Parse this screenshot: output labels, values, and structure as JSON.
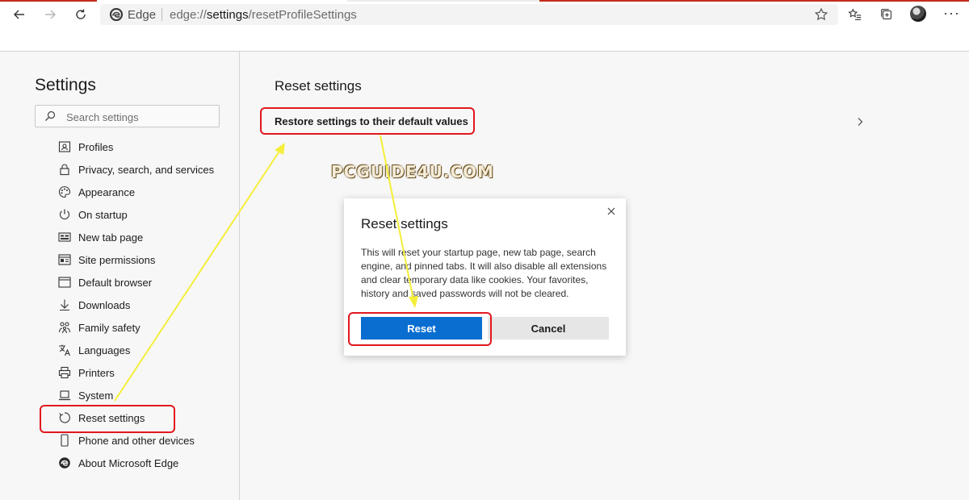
{
  "browser": {
    "brand": "Edge",
    "url_prefix": "edge://",
    "url_strong": "settings",
    "url_rest": "/resetProfileSettings"
  },
  "sidebar": {
    "title": "Settings",
    "search_placeholder": "Search settings",
    "items": [
      {
        "label": "Profiles",
        "icon": "profile-icon"
      },
      {
        "label": "Privacy, search, and services",
        "icon": "lock-icon"
      },
      {
        "label": "Appearance",
        "icon": "palette-icon"
      },
      {
        "label": "On startup",
        "icon": "power-icon"
      },
      {
        "label": "New tab page",
        "icon": "newtab-icon"
      },
      {
        "label": "Site permissions",
        "icon": "site-permissions-icon"
      },
      {
        "label": "Default browser",
        "icon": "browser-icon"
      },
      {
        "label": "Downloads",
        "icon": "download-icon"
      },
      {
        "label": "Family safety",
        "icon": "family-icon"
      },
      {
        "label": "Languages",
        "icon": "language-icon"
      },
      {
        "label": "Printers",
        "icon": "printer-icon"
      },
      {
        "label": "System",
        "icon": "laptop-icon"
      },
      {
        "label": "Reset settings",
        "icon": "reset-icon"
      },
      {
        "label": "Phone and other devices",
        "icon": "phone-icon"
      },
      {
        "label": "About Microsoft Edge",
        "icon": "edge-logo-icon"
      }
    ]
  },
  "main": {
    "title": "Reset settings",
    "restore_label": "Restore settings to their default values"
  },
  "watermark": "PCGUIDE4U.COM",
  "dialog": {
    "title": "Reset settings",
    "body": "This will reset your startup page, new tab page, search engine, and pinned tabs. It will also disable all extensions and clear temporary data like cookies. Your favorites, history and saved passwords will not be cleared.",
    "reset_label": "Reset",
    "cancel_label": "Cancel"
  },
  "colors": {
    "accent": "#0a6ed1",
    "highlight": "#e1181e",
    "arrow": "#f5ee3a"
  }
}
